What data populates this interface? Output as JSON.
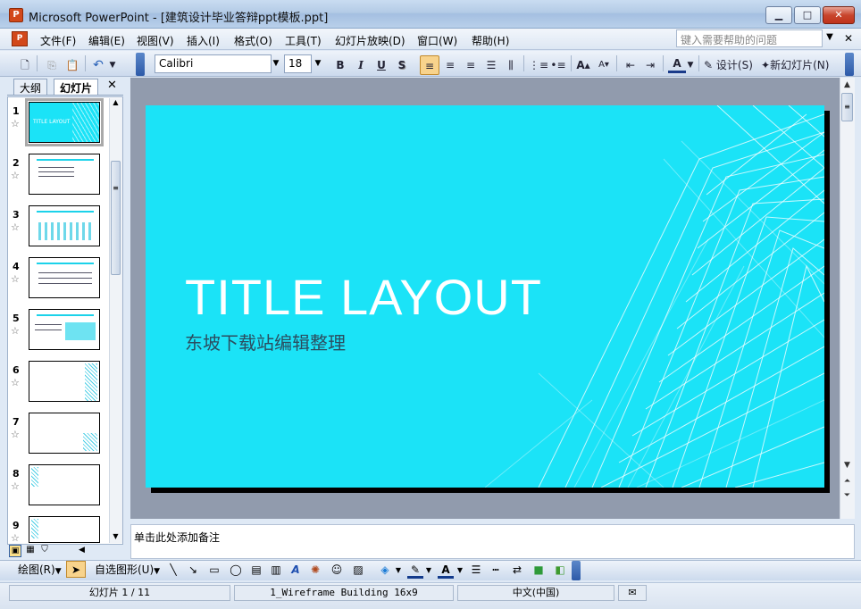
{
  "window": {
    "title": "Microsoft PowerPoint - [建筑设计毕业答辩ppt模板.ppt]",
    "app_icon_glyph": "P",
    "controls": {
      "minimize": "▁",
      "maximize": "□",
      "close": "✕"
    }
  },
  "menu": {
    "items": [
      "文件(F)",
      "编辑(E)",
      "视图(V)",
      "插入(I)",
      "格式(O)",
      "工具(T)",
      "幻灯片放映(D)",
      "窗口(W)",
      "帮助(H)"
    ],
    "help_placeholder": "键入需要帮助的问题"
  },
  "toolbar": {
    "font": "Calibri",
    "size": "18",
    "bold": "B",
    "italic": "I",
    "underline": "U",
    "shadow": "S",
    "design_label": "设计(S)",
    "new_slide_label": "新幻灯片(N)"
  },
  "outline_pane": {
    "tabs": [
      "大纲",
      "幻灯片"
    ],
    "close": "✕",
    "slides": [
      {
        "num": "1",
        "label": "TITLE LAYOUT"
      },
      {
        "num": "2"
      },
      {
        "num": "3"
      },
      {
        "num": "4"
      },
      {
        "num": "5"
      },
      {
        "num": "6"
      },
      {
        "num": "7"
      },
      {
        "num": "8"
      },
      {
        "num": "9"
      }
    ]
  },
  "slide": {
    "title": "TITLE LAYOUT",
    "subtitle": "东坡下载站编辑整理"
  },
  "notes": {
    "placeholder": "单击此处添加备注"
  },
  "drawing": {
    "draw_label": "绘图(R)",
    "autoshape_label": "自选图形(U)"
  },
  "status": {
    "slide_info": "幻灯片 1 / 11",
    "template": "1_Wireframe Building 16x9",
    "language": "中文(中国)"
  },
  "colors": {
    "slide_bg": "#1be3f7",
    "title_text": "#ffffff"
  }
}
